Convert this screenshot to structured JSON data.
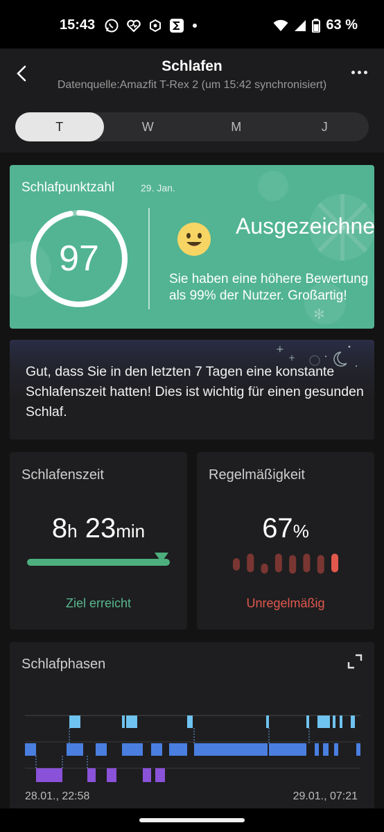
{
  "status_bar": {
    "time": "15:43",
    "battery": "63 %",
    "left_icons": [
      "whatsapp-icon",
      "heart-icon",
      "app-icon",
      "sigma-icon",
      "dot-icon"
    ],
    "right_icons": [
      "wifi-icon",
      "signal-icon",
      "battery-icon"
    ]
  },
  "header": {
    "title": "Schlafen",
    "subtitle": "Datenquelle:Amazfit T-Rex 2 (um 15:42 synchronisiert)"
  },
  "tabs": [
    {
      "label": "T",
      "active": true
    },
    {
      "label": "W",
      "active": false
    },
    {
      "label": "M",
      "active": false
    },
    {
      "label": "J",
      "active": false
    }
  ],
  "score_card": {
    "label": "Schlafpunktzahl",
    "date": "29. Jan.",
    "score": "97",
    "score_fraction": 0.97,
    "rating": "Ausgezeichnet",
    "description": "Sie haben eine höhere Bewertung als 99% der Nutzer. Großartig!",
    "color": "#52b493"
  },
  "tip": {
    "text": "Gut, dass Sie in den letzten 7 Tagen eine konstante Schlafenszeit hatten! Dies ist wichtig für einen gesunden Schlaf."
  },
  "sleep_time": {
    "title": "Schlafenszeit",
    "hours": "8",
    "hours_unit": "h",
    "minutes": "23",
    "minutes_unit": "min",
    "goal_progress": 1.0,
    "status": "Ziel erreicht"
  },
  "regularity": {
    "title": "Regelmäßigkeit",
    "value": "67",
    "unit": "%",
    "status": "Unregelmäßig",
    "bar_levels": [
      0.5,
      0.75,
      0.4,
      0.75,
      0.75,
      0.75,
      0.75,
      0.75
    ]
  },
  "sleep_phases": {
    "title": "Schlafphasen",
    "start": "28.01., 22:58",
    "end": "29.01., 07:21",
    "colors": {
      "awake": "#6fc3f0",
      "light": "#4a7fe0",
      "deep": "#8a52d8"
    }
  }
}
